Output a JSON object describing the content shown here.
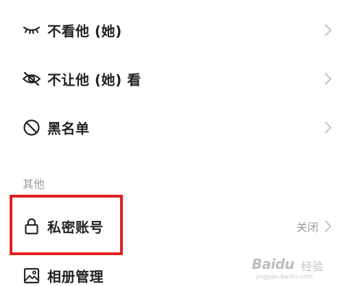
{
  "settings": {
    "items": [
      {
        "label": "不看他 (她)",
        "icon": "closed-eye-icon"
      },
      {
        "label": "不让他 (她) 看",
        "icon": "eye-slash-icon"
      },
      {
        "label": "黑名单",
        "icon": "block-icon"
      }
    ],
    "other_section_title": "其他",
    "private_account": {
      "label": "私密账号",
      "value": "关闭",
      "icon": "lock-icon"
    },
    "album_management": {
      "label": "相册管理",
      "icon": "image-icon"
    }
  },
  "annotation": {
    "highlight_color": "#e41d1d"
  },
  "watermark": {
    "logo": "Baidu",
    "logo_cn": "经验",
    "url": "jingyan.baidu.com"
  }
}
